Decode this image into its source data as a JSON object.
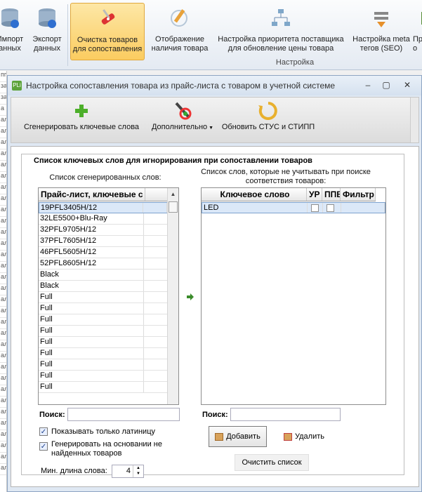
{
  "ribbon": {
    "buttons": [
      {
        "label": "Импорт\nанных",
        "icon": "database-import-icon"
      },
      {
        "label": "Экспорт\nданных",
        "icon": "database-export-icon"
      },
      {
        "label": "Очистка товаров\nдля сопоставления",
        "icon": "swiss-knife-icon"
      },
      {
        "label": "Отображение\nналичия товара",
        "icon": "pencil-check-icon"
      },
      {
        "label": "Настройка приоритета поставщика\nдля обновление цены товара",
        "icon": "hierarchy-icon"
      },
      {
        "label": "Настройка meta\nтегов (SEO)",
        "icon": "meta-tags-icon"
      },
      {
        "label": "Пр\nо",
        "icon": "partial-icon"
      }
    ],
    "group_label": "Настройка"
  },
  "window": {
    "title": "Настройка сопоставления товара из прайс-листа с товаром в учетной системе",
    "app_icon": "PLi",
    "controls": {
      "minimize": "–",
      "maximize": "▢",
      "close": "✕"
    }
  },
  "toolbar": {
    "generate": "Сгенерировать ключевые слова",
    "more": "Дополнительно",
    "update": "Обновить СТУС и СТИПП"
  },
  "group": {
    "title": "Список ключевых слов для игнорирования при сопоставлении товаров",
    "left_caption": "Список сгенерированных слов:",
    "right_caption": "Список слов, которые не учитывать при поиске\nсоответствия товаров:"
  },
  "left_grid": {
    "header": "Прайс-лист, ключевые с",
    "rows": [
      "19PFL3405H/12",
      "32LE5500+Blu-Ray",
      "32PFL9705H/12",
      "37PFL7605H/12",
      "46PFL5605H/12",
      "52PFL8605H/12",
      "Black",
      "Black",
      "Full",
      "Full",
      "Full",
      "Full",
      "Full",
      "Full",
      "Full",
      "Full",
      "Full"
    ]
  },
  "right_grid": {
    "headers": [
      "Ключевое слово",
      "УР",
      "ППВ",
      "Фильтр"
    ],
    "rows": [
      {
        "keyword": "LED"
      }
    ]
  },
  "search_left": {
    "label": "Поиск:",
    "value": ""
  },
  "search_right": {
    "label": "Поиск:",
    "value": ""
  },
  "options": {
    "latin_only": "Показывать только латиницу",
    "generate_not_found": "Генерировать на основании не\nнайденных товаров",
    "min_length_label": "Мин. длина слова:",
    "min_length_value": "4"
  },
  "buttons": {
    "add": "Добавить",
    "delete": "Удалить",
    "clear": "Очистить список"
  },
  "bg_strip": [
    "пп",
    "за",
    "за",
    "а",
    "ал",
    "ал",
    "ал",
    "ал",
    "ал",
    "ал",
    "ал",
    "ал",
    "ал",
    "ал",
    "ал",
    "ал",
    "ал",
    "ал",
    "ал",
    "ал",
    "ал",
    "ал",
    "ал",
    "ал",
    "ал",
    "ал",
    "ал",
    "ал",
    "ал",
    "ал",
    "ал",
    "ал",
    "ал",
    "ал",
    "ал",
    "ал"
  ]
}
